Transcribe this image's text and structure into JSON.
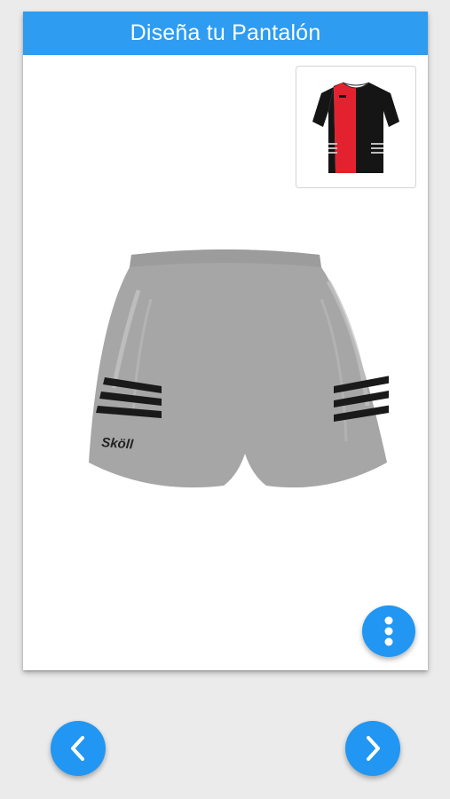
{
  "header": {
    "title": "Diseña tu Pantalón"
  },
  "preview": {
    "jersey_icon": "jersey-icon",
    "jersey_colors": {
      "left": "#e4222f",
      "right": "#111111",
      "stripes": "#bdbdbd"
    }
  },
  "shorts": {
    "base_color": "#a6a6a6",
    "stripe_color": "#1a1a1a",
    "brand_text": "Sköll"
  },
  "actions": {
    "menu_icon": "more-vertical-icon",
    "prev_icon": "chevron-left-icon",
    "next_icon": "chevron-right-icon"
  },
  "colors": {
    "accent": "#2196f3",
    "header": "#2d9cf1",
    "background": "#ebebeb"
  }
}
